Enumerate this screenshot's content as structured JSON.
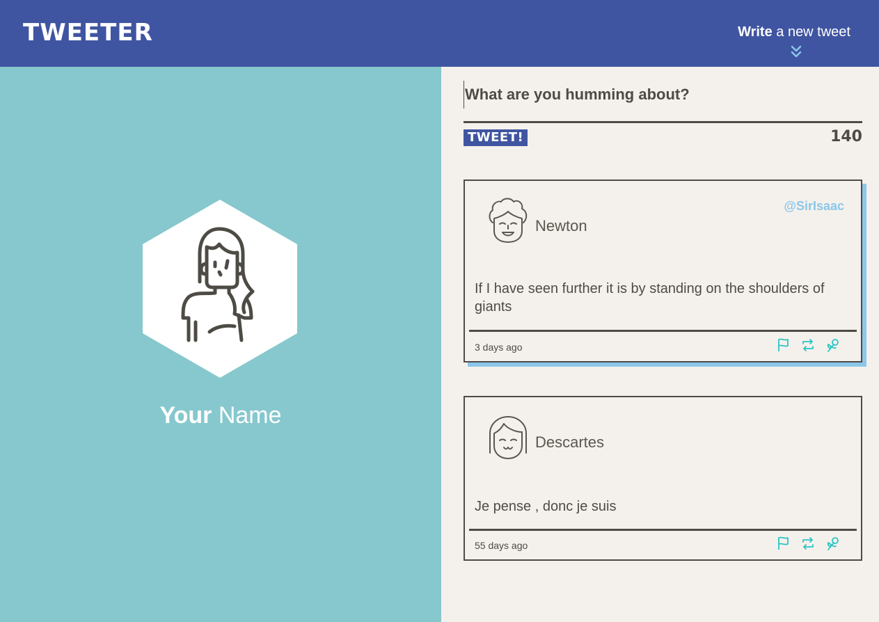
{
  "header": {
    "logo": "TWEETER",
    "write_bold": "Write",
    "write_rest": " a new tweet"
  },
  "profile": {
    "first": "Your",
    "last": " Name"
  },
  "composer": {
    "placeholder": "What are you humming about?",
    "button": "TWEET!",
    "counter": "140"
  },
  "tweets": [
    {
      "author": "Newton",
      "handle": "@SirIsaac",
      "text": "If I have seen further it is by standing on the shoulders of giants",
      "time": "3 days ago"
    },
    {
      "author": "Descartes",
      "handle": "",
      "text": "Je pense , donc je suis",
      "time": "55 days ago"
    }
  ],
  "colors": {
    "header": "#4055a1",
    "profile_bg": "#86c8cd",
    "content_bg": "#f4f1ec",
    "accent": "#8cc7ea",
    "action_icons": "#2bc4c4"
  },
  "icons": [
    "flag-icon",
    "retweet-icon",
    "flower-icon",
    "chevron-down-icon"
  ]
}
